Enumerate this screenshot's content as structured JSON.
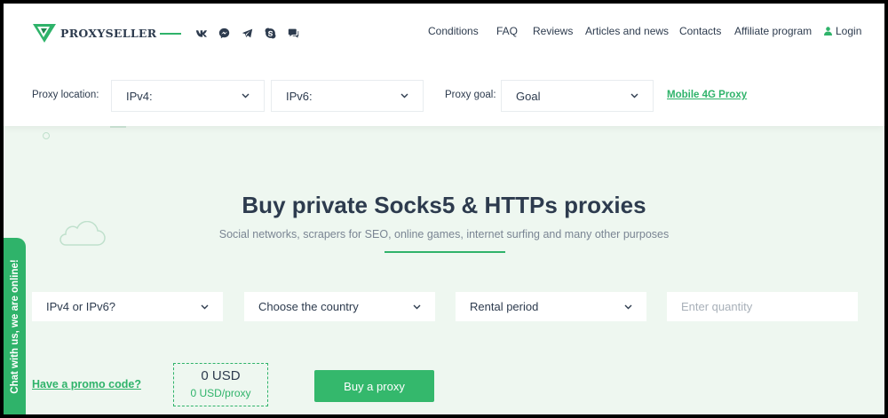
{
  "brand": {
    "name": "PROXYSELLER"
  },
  "socials": [
    {
      "icon": "vk-icon"
    },
    {
      "icon": "messenger-icon"
    },
    {
      "icon": "telegram-icon"
    },
    {
      "icon": "skype-icon"
    },
    {
      "icon": "chat-icon"
    }
  ],
  "nav": {
    "conditions": "Conditions",
    "faq": "FAQ",
    "reviews": "Reviews",
    "articles": "Articles and news",
    "contacts": "Contacts",
    "affiliate": "Affiliate program",
    "login": "Login"
  },
  "filters": {
    "location_label": "Proxy location:",
    "ipv4": "IPv4:",
    "ipv6": "IPv6:",
    "goal_label": "Proxy goal:",
    "goal_value": "Goal",
    "mobile_link": "Mobile 4G Proxy"
  },
  "hero": {
    "title": "Buy private Socks5 & HTTPs proxies",
    "subtitle": "Social networks, scrapers for SEO, online games, internet surfing and many other purposes"
  },
  "order": {
    "ip_version": "IPv4 or IPv6?",
    "country": "Choose the country",
    "rental": "Rental period",
    "quantity_placeholder": "Enter quantity",
    "promo": "Have a promo code?",
    "price_total": "0 USD",
    "price_per": "0 USD/proxy",
    "buy_button": "Buy a proxy"
  },
  "chat": {
    "label": "Chat with us, we are online!"
  },
  "colors": {
    "accent": "#2fb36a",
    "text": "#2d3b4e",
    "hero_bg": "#eef7f0"
  }
}
